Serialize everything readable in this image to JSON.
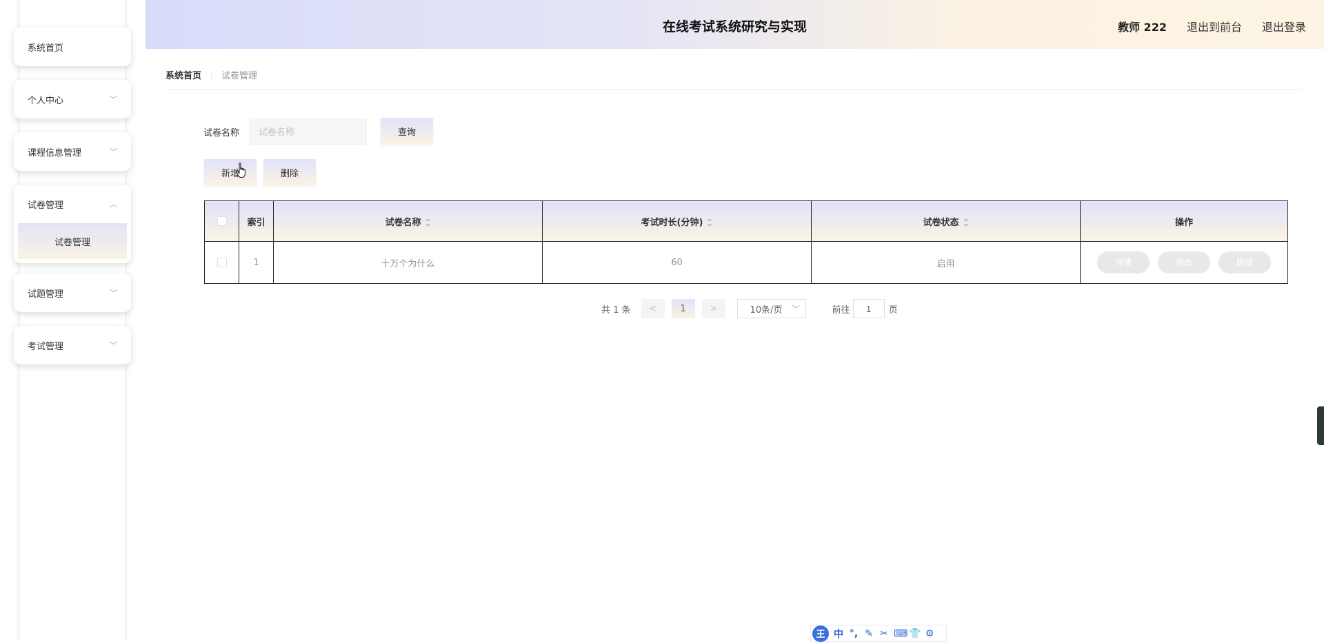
{
  "app": {
    "title": "在线考试系统研究与实现"
  },
  "header": {
    "user": "教师 222",
    "to_front": "退出到前台",
    "logout": "退出登录"
  },
  "sidebar": {
    "items": [
      {
        "label": "系统首页",
        "has_children": false
      },
      {
        "label": "个人中心",
        "has_children": true,
        "expanded": false
      },
      {
        "label": "课程信息管理",
        "has_children": true,
        "expanded": false
      },
      {
        "label": "试卷管理",
        "has_children": true,
        "expanded": true,
        "children": [
          {
            "label": "试卷管理",
            "active": true
          }
        ]
      },
      {
        "label": "试题管理",
        "has_children": true,
        "expanded": false
      },
      {
        "label": "考试管理",
        "has_children": true,
        "expanded": false
      }
    ]
  },
  "breadcrumb": {
    "home": "系统首页",
    "separator": "⋮",
    "current": "试卷管理"
  },
  "search": {
    "label": "试卷名称",
    "placeholder": "试卷名称",
    "value": "",
    "button": "查询"
  },
  "actions": {
    "add": "新增",
    "delete": "删除"
  },
  "table": {
    "headers": {
      "index": "索引",
      "name": "试卷名称",
      "duration": "考试时长(分钟)",
      "status": "试卷状态",
      "ops": "操作"
    },
    "rows": [
      {
        "index": "1",
        "name": "十万个为什么",
        "duration": "60",
        "status": "启用"
      }
    ],
    "row_actions": {
      "detail": "详情",
      "edit": "修改",
      "delete": "删除"
    }
  },
  "pagination": {
    "total_text": "共 1 条",
    "prev": "<",
    "current_page": "1",
    "next": ">",
    "page_size": "10条/页",
    "goto_label": "前往",
    "goto_value": "1",
    "goto_suffix": "页"
  },
  "ime_toolbar": {
    "logo": "王",
    "icons": [
      "中",
      "°,",
      "✎",
      "✂",
      "⌨",
      "👕",
      "⚙"
    ]
  },
  "colors": {
    "header_gradient_start": "#d8dcf9",
    "header_gradient_end": "#fdf4e3",
    "disabled_button": "#e8e8e8",
    "ime_blue": "#3b6fe0"
  }
}
